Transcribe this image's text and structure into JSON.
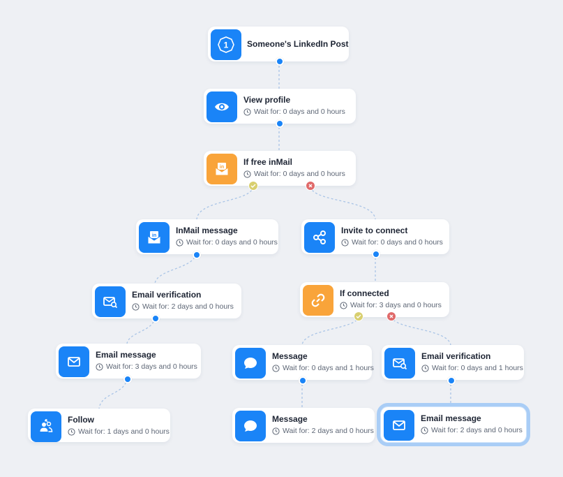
{
  "trigger": {
    "step": "1",
    "title": "Someone's LinkedIn Post"
  },
  "wait_prefix": "Wait for:",
  "nodes": {
    "view_profile": {
      "title": "View profile",
      "wait": "Wait for: 0 days and 0 hours",
      "icon": "eye-icon"
    },
    "if_free_inmail": {
      "title": "If free inMail",
      "wait": "Wait for: 0 days and 0 hours",
      "icon": "inmail-envelope-icon"
    },
    "inmail_message": {
      "title": "InMail message",
      "wait": "Wait for: 0 days and 0 hours",
      "icon": "inmail-envelope-icon"
    },
    "invite_to_connect": {
      "title": "Invite to connect",
      "wait": "Wait for: 0 days and 0 hours",
      "icon": "share-nodes-icon"
    },
    "email_verification_left": {
      "title": "Email verification",
      "wait": "Wait for: 2 days and 0 hours",
      "icon": "email-search-icon"
    },
    "if_connected": {
      "title": "If connected",
      "wait": "Wait for: 3 days and 0 hours",
      "icon": "link-icon"
    },
    "email_message_left": {
      "title": "Email message",
      "wait": "Wait for: 3 days and 0 hours",
      "icon": "envelope-icon"
    },
    "message_1": {
      "title": "Message",
      "wait": "Wait for: 0 days and 1 hours",
      "icon": "chat-bubble-icon"
    },
    "email_verification_right": {
      "title": "Email verification",
      "wait": "Wait for: 0 days and 1 hours",
      "icon": "email-search-icon"
    },
    "follow": {
      "title": "Follow",
      "wait": "Wait for: 1 days and 0 hours",
      "icon": "follow-users-icon"
    },
    "message_2": {
      "title": "Message",
      "wait": "Wait for: 2 days and 0 hours",
      "icon": "chat-bubble-icon"
    },
    "email_message_right": {
      "title": "Email message",
      "wait": "Wait for: 2 days and 0 hours",
      "icon": "envelope-icon"
    }
  },
  "colors": {
    "background": "#eef0f4",
    "action_blue": "#1a84f7",
    "condition_orange": "#f9a43a",
    "yes_badge": "#d8cf6f",
    "no_badge": "#e06a6a",
    "selected_outline": "#a9cdf6"
  },
  "selected_node": "email_message_right"
}
